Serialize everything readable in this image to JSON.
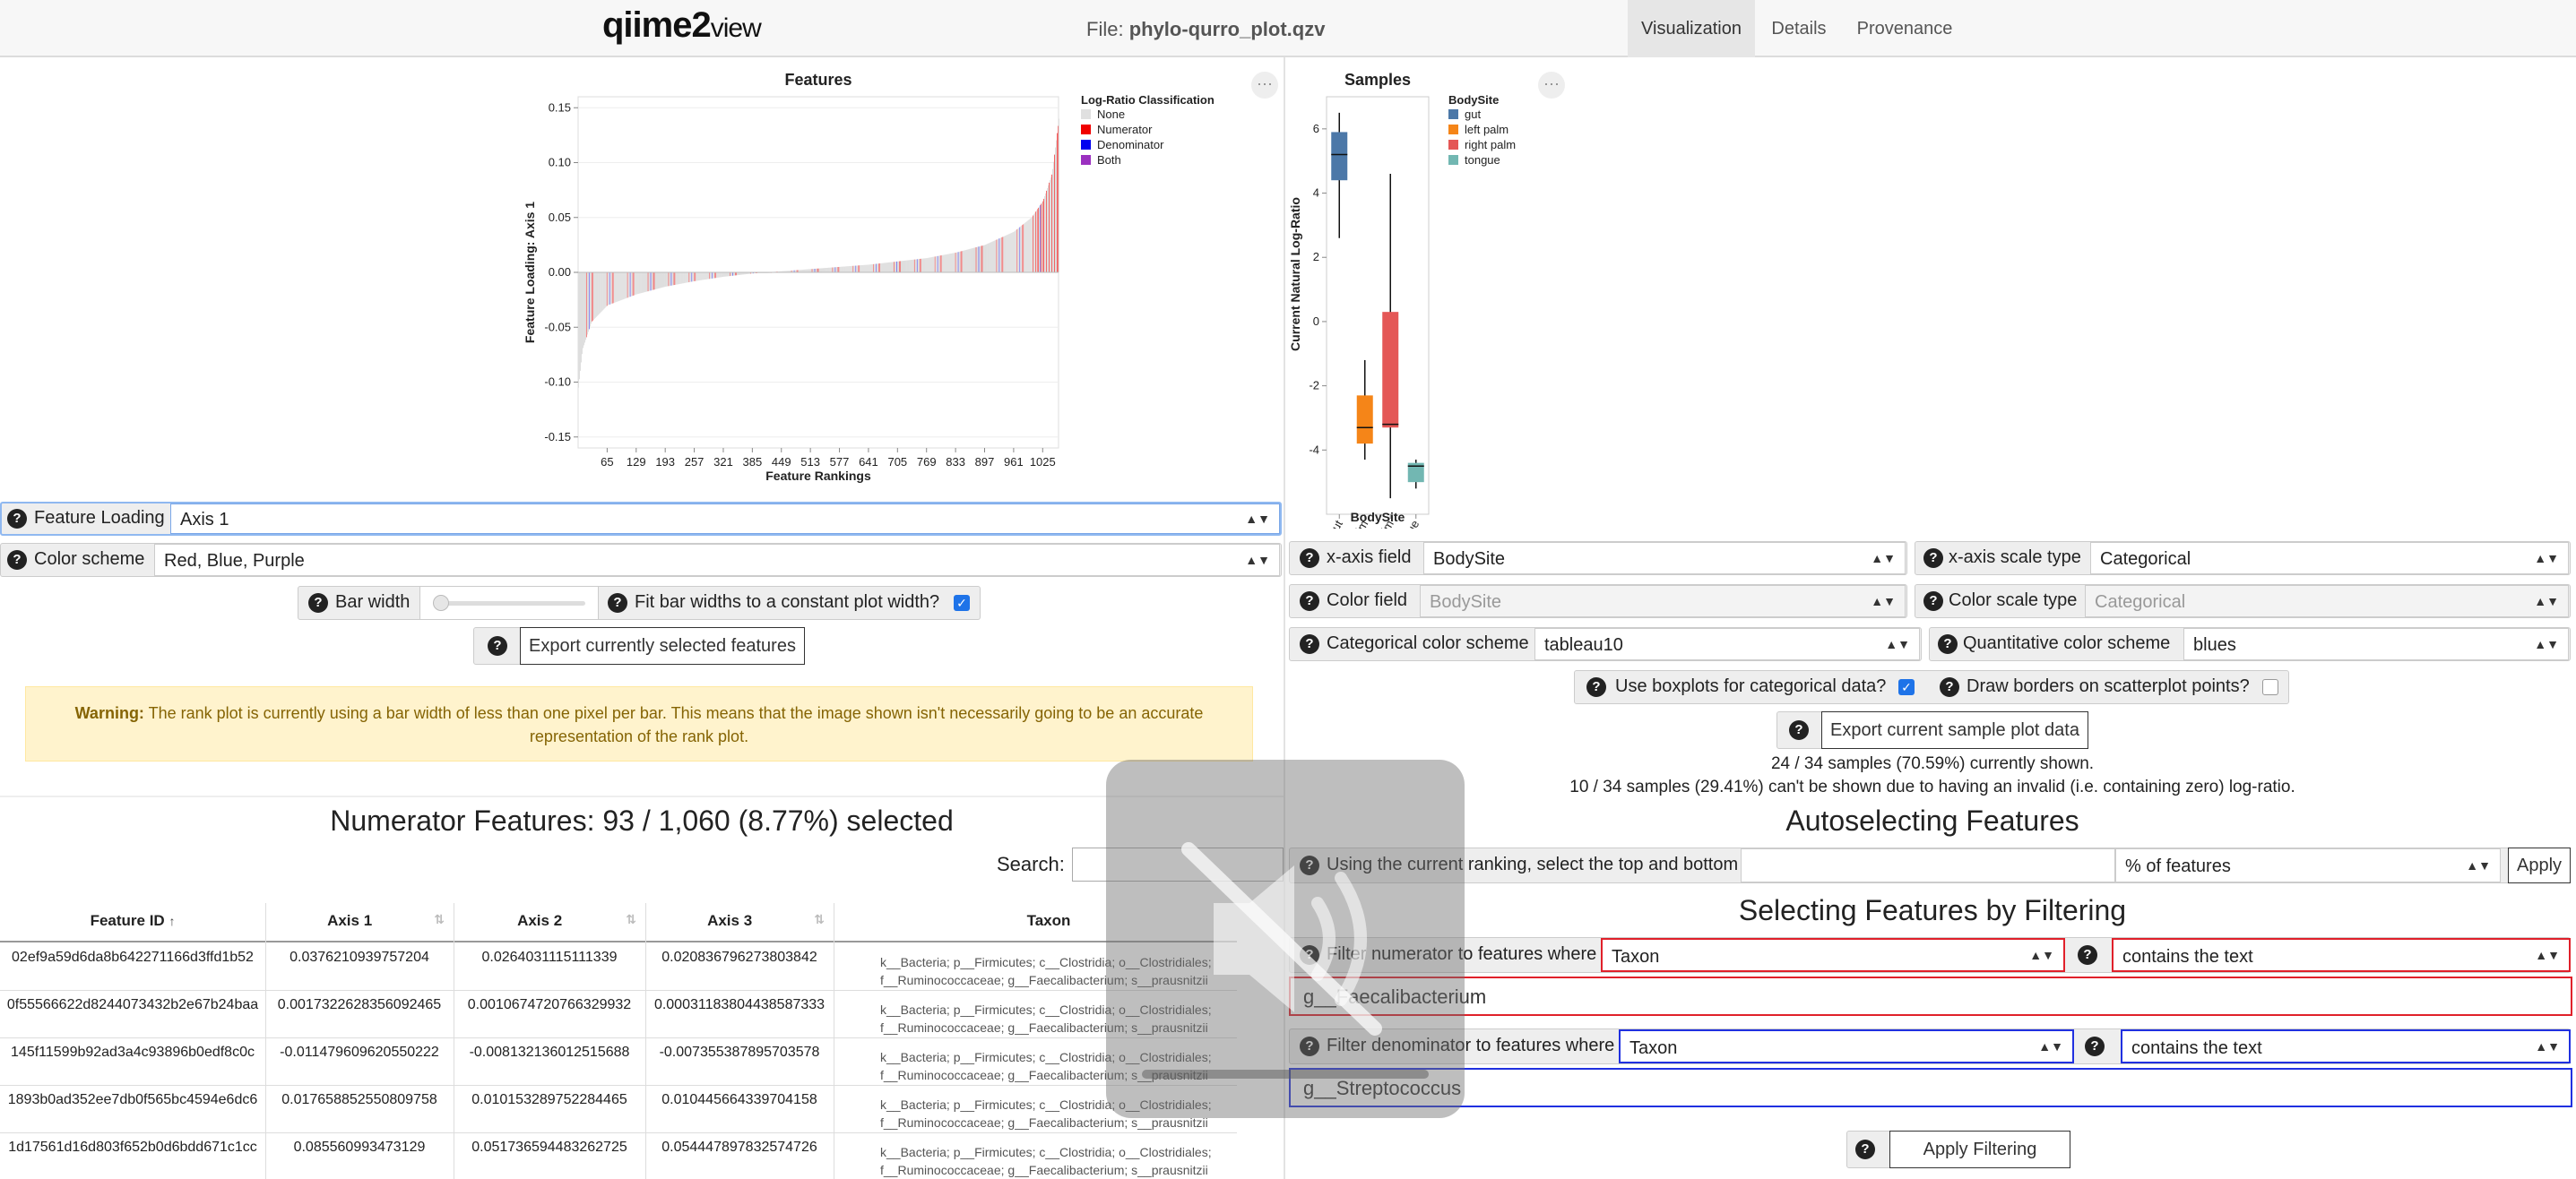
{
  "navbar": {
    "logo_main": "qiime",
    "logo_two": "2",
    "logo_view": "view",
    "file_label": "File:",
    "file_name": "phylo-qurro_plot.qzv",
    "tabs": [
      "Visualization",
      "Details",
      "Provenance"
    ],
    "active_tab": "Visualization"
  },
  "features_chart": {
    "title": "Features",
    "xlabel": "Feature Rankings",
    "ylabel": "Feature Loading: Axis 1",
    "y_ticks": [
      "0.15",
      "0.10",
      "0.05",
      "0.00",
      "-0.05",
      "-0.10",
      "-0.15"
    ],
    "x_ticks": [
      "65",
      "129",
      "193",
      "257",
      "321",
      "385",
      "449",
      "513",
      "577",
      "641",
      "705",
      "769",
      "833",
      "897",
      "961",
      "1025"
    ],
    "legend_title": "Log-Ratio Classification",
    "legend": [
      {
        "label": "None",
        "color": "#e0e0e0"
      },
      {
        "label": "Numerator",
        "color": "#f00000"
      },
      {
        "label": "Denominator",
        "color": "#0000f0"
      },
      {
        "label": "Both",
        "color": "#9b30c0"
      }
    ],
    "menu_icon": "ellipsis-icon"
  },
  "samples_chart": {
    "title": "Samples",
    "xlabel": "BodySite",
    "ylabel": "Current Natural Log-Ratio",
    "y_ticks": [
      "6",
      "4",
      "2",
      "0",
      "-2",
      "-4"
    ],
    "categories": [
      "gut",
      "left palm",
      "right palm",
      "tongue"
    ],
    "legend_title": "BodySite",
    "legend": [
      {
        "label": "gut",
        "color": "#4c78a8"
      },
      {
        "label": "left palm",
        "color": "#f58518"
      },
      {
        "label": "right palm",
        "color": "#e45756"
      },
      {
        "label": "tongue",
        "color": "#72b7b2"
      }
    ],
    "menu_icon": "ellipsis-icon"
  },
  "chart_data": [
    {
      "type": "bar",
      "title": "Features",
      "xlabel": "Feature Rankings",
      "ylabel": "Feature Loading: Axis 1",
      "ylim": [
        -0.16,
        0.16
      ],
      "xlim": [
        1,
        1060
      ],
      "x_ticks": [
        65,
        129,
        193,
        257,
        321,
        385,
        449,
        513,
        577,
        641,
        705,
        769,
        833,
        897,
        961,
        1025
      ],
      "curve": {
        "rank": [
          1,
          10,
          30,
          65,
          129,
          193,
          257,
          321,
          385,
          449,
          513,
          577,
          641,
          705,
          769,
          833,
          897,
          961,
          1000,
          1025,
          1045,
          1060
        ],
        "loading": [
          -0.105,
          -0.07,
          -0.045,
          -0.03,
          -0.02,
          -0.013,
          -0.008,
          -0.004,
          -0.001,
          0.001,
          0.003,
          0.005,
          0.007,
          0.01,
          0.013,
          0.018,
          0.025,
          0.037,
          0.05,
          0.065,
          0.09,
          0.14
        ]
      },
      "legend": [
        "None",
        "Numerator",
        "Denominator",
        "Both"
      ]
    },
    {
      "type": "box",
      "title": "Samples",
      "xlabel": "BodySite",
      "ylabel": "Current Natural Log-Ratio",
      "ylim": [
        -6,
        7
      ],
      "categories": [
        "gut",
        "left palm",
        "right palm",
        "tongue"
      ],
      "boxes": [
        {
          "category": "gut",
          "min": 2.6,
          "q1": 4.4,
          "median": 5.2,
          "q3": 5.9,
          "max": 6.5
        },
        {
          "category": "left palm",
          "min": -4.3,
          "q1": -3.8,
          "median": -3.3,
          "q3": -2.3,
          "max": -1.2
        },
        {
          "category": "right palm",
          "min": -5.5,
          "q1": -3.3,
          "median": -3.2,
          "q3": 0.3,
          "max": 4.6
        },
        {
          "category": "tongue",
          "min": -5.2,
          "q1": -5.0,
          "median": -4.5,
          "q3": -4.4,
          "max": -4.3
        }
      ]
    }
  ],
  "controls_left": {
    "feature_loading_label": "Feature Loading",
    "feature_loading_value": "Axis 1",
    "color_scheme_label": "Color scheme",
    "color_scheme_value": "Red, Blue, Purple",
    "bar_width_label": "Bar width",
    "fit_bar_label": "Fit bar widths to a constant plot width?",
    "fit_bar_checked": true,
    "export_features": "Export currently selected features",
    "warning_bold": "Warning:",
    "warning_text": "The rank plot is currently using a bar width of less than one pixel per bar. This means that the image shown isn't necessarily going to be an accurate representation of the rank plot."
  },
  "controls_right": {
    "x_axis_field_label": "x-axis field",
    "x_axis_field_value": "BodySite",
    "x_axis_scale_label": "x-axis scale type",
    "x_axis_scale_value": "Categorical",
    "color_field_label": "Color field",
    "color_field_value": "BodySite",
    "color_scale_label": "Color scale type",
    "color_scale_value": "Categorical",
    "cat_color_label": "Categorical color scheme",
    "cat_color_value": "tableau10",
    "quant_color_label": "Quantitative color scheme",
    "quant_color_value": "blues",
    "boxplot_label": "Use boxplots for categorical data?",
    "boxplot_checked": true,
    "borders_label": "Draw borders on scatterplot points?",
    "borders_checked": false,
    "export_samples": "Export current sample plot data",
    "shown_text": "24 / 34 samples (70.59%) currently shown.",
    "hidden_text": "10 / 34 samples (29.41%) can't be shown due to having an invalid (i.e. containing zero) log-ratio."
  },
  "table": {
    "heading": "Numerator Features: 93 / 1,060 (8.77%) selected",
    "search_label": "Search:",
    "columns": [
      "Feature ID",
      "Axis 1",
      "Axis 2",
      "Axis 3",
      "Taxon"
    ],
    "rows": [
      {
        "id": "02ef9a59d6da8b642271166d3ffd1b52",
        "a1": "0.037621093975720​4",
        "a2": "0.0264031115111339",
        "a3": "0.0208367962738038​42",
        "t1": "k__Bacteria; p__Firmicutes; c__Clostridia; o__Clostridiales;",
        "t2": "f__Ruminococcaceae; g__Faecalibacterium; s__prausnitzii"
      },
      {
        "id": "0f55566622d8244073432b2e67b24baa",
        "a1": "0.0017322628356092465",
        "a2": "0.0010674720766329932",
        "a3": "0.00031183804438587333",
        "t1": "k__Bacteria; p__Firmicutes; c__Clostridia; o__Clostridiales;",
        "t2": "f__Ruminococcaceae; g__Faecalibacterium; s__prausnitzii"
      },
      {
        "id": "145f11599b92ad3a4c93896b0edf8c0c",
        "a1": "-0.011479609620550222",
        "a2": "-0.008132136012515688",
        "a3": "-0.007355387895703578",
        "t1": "k__Bacteria; p__Firmicutes; c__Clostridia; o__Clostridiales;",
        "t2": "f__Ruminococcaceae; g__Faecalibacterium; s__prausnitzii"
      },
      {
        "id": "1893b0ad352ee7db0f565bc4594e6dc6",
        "a1": "0.017658852550809758",
        "a2": "0.010153289752284465",
        "a3": "0.010445664339704158",
        "t1": "k__Bacteria; p__Firmicutes; c__Clostridia; o__Clostridiales;",
        "t2": "f__Ruminococcaceae; g__Faecalibacterium; s__prausnitzii"
      },
      {
        "id": "1d17561d16d803f652b0d6bdd671c1cc",
        "a1": "0.085560993473129",
        "a2": "0.051736594483262725",
        "a3": "0.054447897832574726",
        "t1": "k__Bacteria; p__Firmicutes; c__Clostridia; o__Clostridiales;",
        "t2": "f__Ruminococcaceae; g__Faecalibacterium; s__prausnitzii"
      }
    ]
  },
  "autoselect": {
    "heading": "Autoselecting Features",
    "label": "Using the current ranking, select the top and bottom",
    "unit_value": "% of features",
    "apply": "Apply"
  },
  "filtering": {
    "heading": "Selecting Features by Filtering",
    "num_label": "Filter numerator to features where",
    "num_field": "Taxon",
    "num_op": "contains the text",
    "num_text": "g__Faecalibacterium",
    "den_label": "Filter denominator to features where",
    "den_field": "Taxon",
    "den_op": "contains the text",
    "den_text": "g__Streptococcus",
    "apply": "Apply Filtering"
  },
  "overlay": {
    "icon": "muted-speaker-icon"
  }
}
